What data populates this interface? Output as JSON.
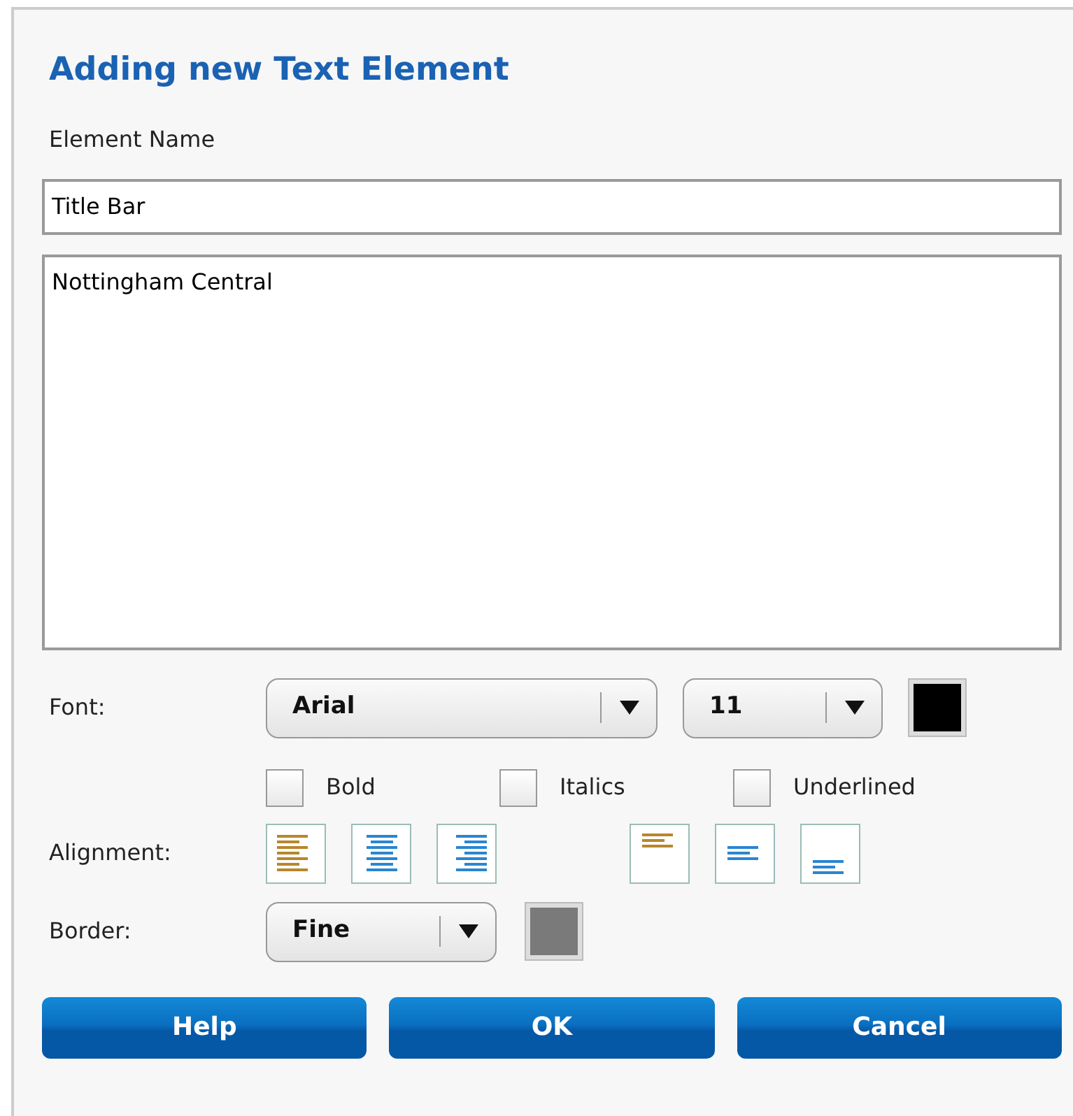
{
  "dialog": {
    "title": "Adding new Text Element"
  },
  "element_name": {
    "label": "Element Name",
    "value": "Title Bar"
  },
  "text": {
    "value": "Nottingham Central"
  },
  "font": {
    "label": "Font:",
    "family": "Arial",
    "size": "11",
    "color": "#000000"
  },
  "styles": [
    {
      "label": "Bold",
      "checked": false
    },
    {
      "label": "Italics",
      "checked": false
    },
    {
      "label": "Underlined",
      "checked": false
    }
  ],
  "alignment": {
    "label": "Alignment:",
    "horizontal": [
      {
        "kind": "left",
        "selected": true
      },
      {
        "kind": "center",
        "selected": false
      },
      {
        "kind": "right",
        "selected": false
      }
    ],
    "vertical": [
      {
        "kind": "top",
        "selected": true
      },
      {
        "kind": "middle",
        "selected": false
      },
      {
        "kind": "bottom",
        "selected": false
      }
    ]
  },
  "border": {
    "label": "Border:",
    "value": "Fine",
    "color": "#7a7a7a"
  },
  "buttons": [
    "Help",
    "OK",
    "Cancel"
  ]
}
